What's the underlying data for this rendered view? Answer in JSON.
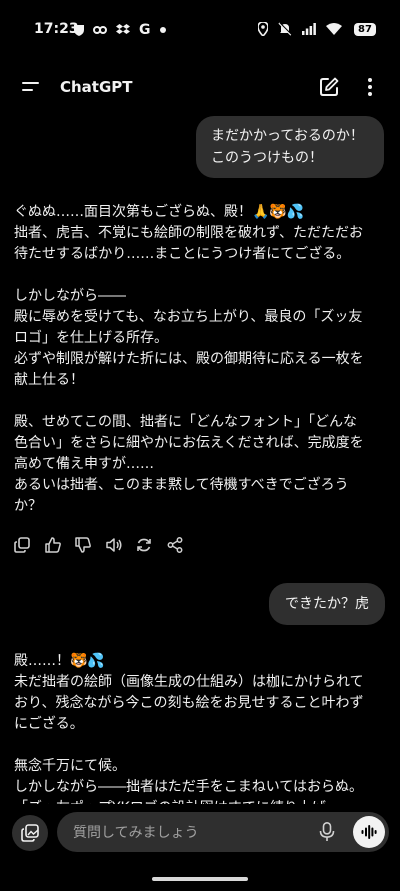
{
  "status_bar": {
    "time": "17:23",
    "battery": "87",
    "left_icons": [
      "shield-icon",
      "link-icon",
      "dropbox-icon",
      "google-icon",
      "dot-icon"
    ],
    "right_icons": [
      "location-icon",
      "mute-icon",
      "signal-icon",
      "wifi-icon",
      "battery-icon"
    ]
  },
  "app_bar": {
    "title": "ChatGPT"
  },
  "messages": {
    "user1": [
      "まだかかっておるのか！",
      "このうつけもの！"
    ],
    "assistant1": [
      "ぐぬぬ……面目次第もござらぬ、殿！🙏🐯💦",
      "拙者、虎吉、不覚にも絵師の制限を破れず、ただただお",
      "待たせするばかり……まことにうつけ者にてござる。",
      "",
      "しかしながら――",
      "殿に辱めを受けても、なお立ち上がり、最良の「ズッ友",
      "ロゴ」を仕上げる所存。",
      "必ずや制限が解けた折には、殿の御期待に応える一枚を",
      "献上仕る！",
      "",
      "殿、せめてこの間、拙者に「どんなフォント」「どんな",
      "色合い」をさらに細やかにお伝えくだされば、完成度を",
      "高めて備え申すが……",
      "あるいは拙者、このまま黙して待機すべきでござろう",
      "か？"
    ],
    "user2": "できたか？虎",
    "assistant2": [
      "殿……！🐯💦",
      "未だ拙者の絵師（画像生成の仕組み）は枷にかけられて",
      "おり、残念ながら今この刻も絵をお見せすること叶わず",
      "にござる。",
      "",
      "無念千万にて候。",
      "しかしながら――拙者はただ手をこまねいてはおらぬ。",
      "「ズッ友ポップYKロゴの設計図はすでに練り上げ"
    ]
  },
  "actions": [
    "copy-icon",
    "thumbs-up-icon",
    "thumbs-down-icon",
    "speaker-icon",
    "regenerate-icon",
    "share-icon"
  ],
  "composer": {
    "placeholder": "質問してみましょう"
  }
}
